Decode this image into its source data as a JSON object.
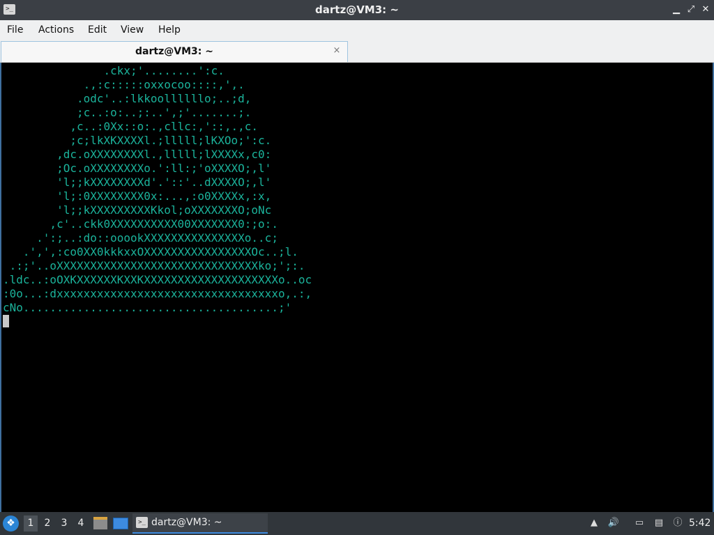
{
  "window": {
    "title": "dartz@VM3: ~",
    "controls": {
      "minimize": "▁",
      "maximize": "⤢",
      "close": "✕"
    }
  },
  "menubar": {
    "items": [
      "File",
      "Actions",
      "Edit",
      "View",
      "Help"
    ]
  },
  "tabs": [
    {
      "label": "dartz@VM3: ~",
      "close_icon": "×"
    }
  ],
  "terminal": {
    "text_color": "#1bb39b",
    "lines": [
      "               .ckx;'........':c.",
      "            .,:c:::::oxxocoo::::,',.",
      "           .odc'..:lkkoollllllo;..;d,",
      "           ;c..:o:..;:..',;'.......;.",
      "          ,c..:0Xx::o:.,cllc:,'::,.,c.",
      "          ;c;lkXKXXXXl.;lllll;lKXOo;':c.",
      "        ,dc.oXXXXXXXXl.,lllll;lXXXXx,c0:",
      "        ;Oc.oXXXXXXXXo.':ll:;'oXXXXO;,l'",
      "        'l;;kXXXXXXXXd'.'::'..dXXXXO;,l'",
      "        'l;:0XXXXXXXX0x:...,:o0XXXXx,:x,",
      "        'l;;kXXXXXXXXXKkol;oXXXXXXXO;oNc",
      "       ,c'..ckk0XXXXXXXXXX00XXXXXXX0:;o:.",
      "     .':;..:do::ooookXXXXXXXXXXXXXXXo..c;",
      "   .',',:co0XX0kkkxxOXXXXXXXXXXXXXXXXOc..;l.",
      " .:;'..oXXXXXXXXXXXXXXXXXXXXXXXXXXXXXXko;';:.",
      ".ldc..:oOXKXXXXXXKXXKXXXXXXXXXXXXXXXXXXXXo..oc",
      ":0o...:dxxxxxxxxxxxxxxxxxxxxxxxxxxxxxxxxxo,.:,",
      "cNo......................................;'"
    ]
  },
  "taskbar": {
    "start_icon": "start-menu-icon",
    "workspaces": [
      "1",
      "2",
      "3",
      "4"
    ],
    "active_workspace": "1",
    "task_label": "dartz@VM3: ~",
    "clock": "5:42",
    "accent": "#3d8be0"
  }
}
